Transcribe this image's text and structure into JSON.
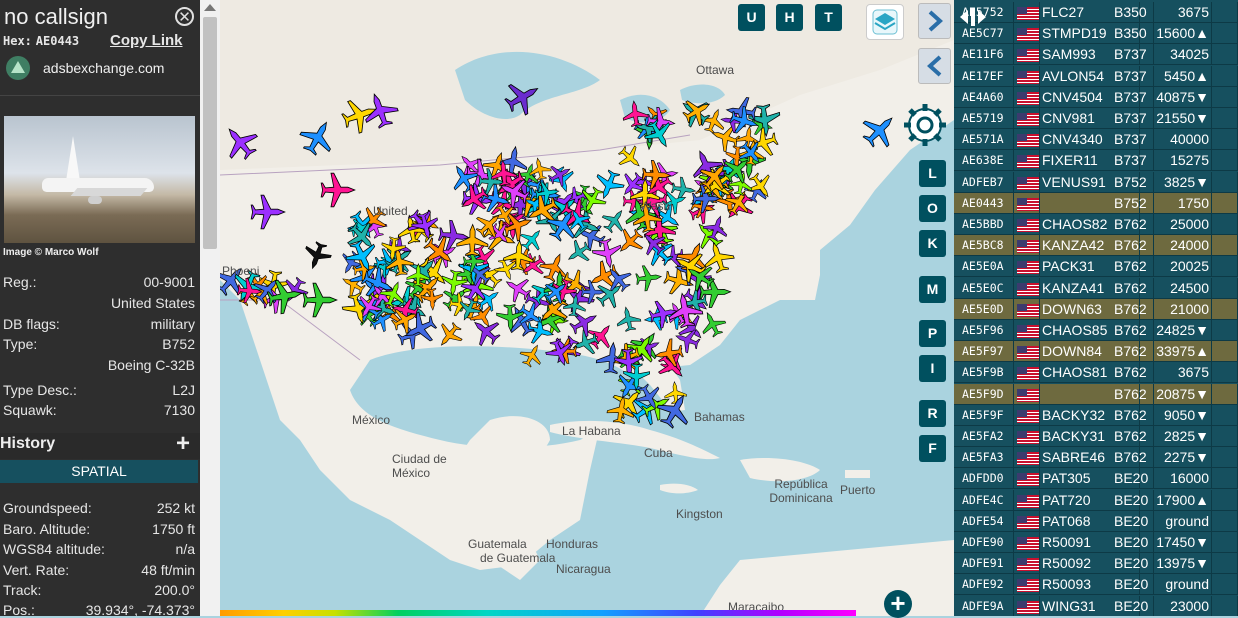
{
  "info": {
    "title": "no callsign",
    "hex_label": "Hex:",
    "hex": "AE0443",
    "copy_link": "Copy Link",
    "source": "adsbexchange.com",
    "image_credit": "Image © Marco Wolf",
    "fields": [
      {
        "k": "Reg.:",
        "v": "00-9001"
      },
      {
        "k": "",
        "v": "United States"
      },
      {
        "k": "DB flags:",
        "v": "military"
      },
      {
        "k": "Type:",
        "v": "B752"
      },
      {
        "k": "",
        "v": "Boeing C-32B"
      },
      {
        "k": "Type Desc.:",
        "v": "L2J"
      },
      {
        "k": "Squawk:",
        "v": "7130"
      }
    ],
    "history": "History",
    "spatial": "SPATIAL",
    "spatial_fields": [
      {
        "k": "Groundspeed:",
        "v": "252 kt"
      },
      {
        "k": "Baro. Altitude:",
        "v": "1750 ft"
      },
      {
        "k": "WGS84 altitude:",
        "v": "n/a"
      },
      {
        "k": "Vert. Rate:",
        "v": "48 ft/min"
      },
      {
        "k": "Track:",
        "v": "200.0°"
      },
      {
        "k": "Pos.:",
        "v": "39.934°, -74.373°"
      }
    ]
  },
  "map": {
    "labels": [
      "Ottawa",
      "United",
      "Washi",
      "México",
      "La Habana",
      "Cuba",
      "Ciudad de México",
      "Bahamas",
      "Puerto",
      "República Dominicana",
      "Kingston",
      "Guatemala",
      "Honduras",
      "Nicaragua",
      "de Guatemala",
      "Maracaibo",
      "Phoeni"
    ],
    "buttons": {
      "u": "U",
      "h": "H",
      "t": "T",
      "side": [
        "L",
        "O",
        "K",
        "M",
        "P",
        "I",
        "R",
        "F"
      ],
      "zoom_in": "+"
    }
  },
  "table": [
    {
      "hex": "AE5752",
      "cs": "FLC27",
      "ty": "B350",
      "alt": "3675",
      "ex": "",
      "hl": false
    },
    {
      "hex": "AE5C77",
      "cs": "STMPD19",
      "ty": "B350",
      "alt": "15600",
      "ex": "▲",
      "hl": false
    },
    {
      "hex": "AE11F6",
      "cs": "SAM993",
      "ty": "B737",
      "alt": "34025",
      "ex": "",
      "hl": false
    },
    {
      "hex": "AE17EF",
      "cs": "AVLON54",
      "ty": "B737",
      "alt": "5450",
      "ex": "▲",
      "hl": false
    },
    {
      "hex": "AE4A60",
      "cs": "CNV4504",
      "ty": "B737",
      "alt": "40875",
      "ex": "▼",
      "hl": false
    },
    {
      "hex": "AE5719",
      "cs": "CNV981",
      "ty": "B737",
      "alt": "21550",
      "ex": "▼",
      "hl": false
    },
    {
      "hex": "AE571A",
      "cs": "CNV4340",
      "ty": "B737",
      "alt": "40000",
      "ex": "",
      "hl": false
    },
    {
      "hex": "AE638E",
      "cs": "FIXER11",
      "ty": "B737",
      "alt": "15275",
      "ex": "",
      "hl": false
    },
    {
      "hex": "ADFEB7",
      "cs": "VENUS91",
      "ty": "B752",
      "alt": "3825",
      "ex": "▼",
      "hl": false
    },
    {
      "hex": "AE0443",
      "cs": "",
      "ty": "B752",
      "alt": "1750",
      "ex": "",
      "hl": true
    },
    {
      "hex": "AE5BBD",
      "cs": "CHAOS82",
      "ty": "B762",
      "alt": "25000",
      "ex": "",
      "hl": false
    },
    {
      "hex": "AE5BC8",
      "cs": "KANZA42",
      "ty": "B762",
      "alt": "24000",
      "ex": "",
      "hl": true
    },
    {
      "hex": "AE5E0A",
      "cs": "PACK31",
      "ty": "B762",
      "alt": "20025",
      "ex": "",
      "hl": false
    },
    {
      "hex": "AE5E0C",
      "cs": "KANZA41",
      "ty": "B762",
      "alt": "24500",
      "ex": "",
      "hl": false
    },
    {
      "hex": "AE5E0D",
      "cs": "DOWN63",
      "ty": "B762",
      "alt": "21000",
      "ex": "",
      "hl": true
    },
    {
      "hex": "AE5F96",
      "cs": "CHAOS85",
      "ty": "B762",
      "alt": "24825",
      "ex": "▼",
      "hl": false
    },
    {
      "hex": "AE5F97",
      "cs": "DOWN84",
      "ty": "B762",
      "alt": "33975",
      "ex": "▲",
      "hl": true
    },
    {
      "hex": "AE5F9B",
      "cs": "CHAOS81",
      "ty": "B762",
      "alt": "3675",
      "ex": "",
      "hl": false
    },
    {
      "hex": "AE5F9D",
      "cs": "",
      "ty": "B762",
      "alt": "20875",
      "ex": "▼",
      "hl": true
    },
    {
      "hex": "AE5F9F",
      "cs": "BACKY32",
      "ty": "B762",
      "alt": "9050",
      "ex": "▼",
      "hl": false
    },
    {
      "hex": "AE5FA2",
      "cs": "BACKY31",
      "ty": "B762",
      "alt": "2825",
      "ex": "▼",
      "hl": false
    },
    {
      "hex": "AE5FA3",
      "cs": "SABRE46",
      "ty": "B762",
      "alt": "2275",
      "ex": "▼",
      "hl": false
    },
    {
      "hex": "ADFDD0",
      "cs": "PAT305",
      "ty": "BE20",
      "alt": "16000",
      "ex": "",
      "hl": false
    },
    {
      "hex": "ADFE4C",
      "cs": "PAT720",
      "ty": "BE20",
      "alt": "17900",
      "ex": "▲",
      "hl": false
    },
    {
      "hex": "ADFE54",
      "cs": "PAT068",
      "ty": "BE20",
      "alt": "ground",
      "ex": "",
      "hl": false
    },
    {
      "hex": "ADFE90",
      "cs": "R50091",
      "ty": "BE20",
      "alt": "17450",
      "ex": "▼",
      "hl": false
    },
    {
      "hex": "ADFE91",
      "cs": "R50092",
      "ty": "BE20",
      "alt": "13975",
      "ex": "▼",
      "hl": false
    },
    {
      "hex": "ADFE92",
      "cs": "R50093",
      "ty": "BE20",
      "alt": "ground",
      "ex": "",
      "hl": false
    },
    {
      "hex": "ADFE9A",
      "cs": "WING31",
      "ty": "BE20",
      "alt": "23000",
      "ex": "",
      "hl": false
    }
  ],
  "colors": {
    "accent": "#00505f",
    "table_bg": "#16505f",
    "highlight": "#6e6a3f",
    "panel_bg": "#2e2e2e"
  }
}
